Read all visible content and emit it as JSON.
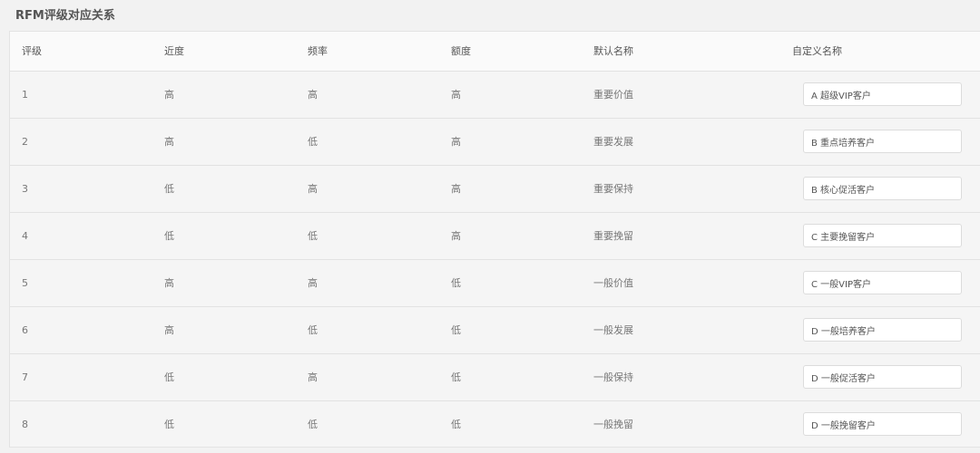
{
  "title": "RFM评级对应关系",
  "headers": [
    "评级",
    "近度",
    "频率",
    "额度",
    "默认名称",
    "自定义名称"
  ],
  "rows": [
    {
      "level": "1",
      "recency": "高",
      "frequency": "高",
      "monetary": "高",
      "default_name": "重要价值",
      "custom_name": "A 超级VIP客户"
    },
    {
      "level": "2",
      "recency": "高",
      "frequency": "低",
      "monetary": "高",
      "default_name": "重要发展",
      "custom_name": "B 重点培养客户"
    },
    {
      "level": "3",
      "recency": "低",
      "frequency": "高",
      "monetary": "高",
      "default_name": "重要保持",
      "custom_name": "B 核心促活客户"
    },
    {
      "level": "4",
      "recency": "低",
      "frequency": "低",
      "monetary": "高",
      "default_name": "重要挽留",
      "custom_name": "C 主要挽留客户"
    },
    {
      "level": "5",
      "recency": "高",
      "frequency": "高",
      "monetary": "低",
      "default_name": "一般价值",
      "custom_name": "C 一般VIP客户"
    },
    {
      "level": "6",
      "recency": "高",
      "frequency": "低",
      "monetary": "低",
      "default_name": "一般发展",
      "custom_name": "D 一般培养客户"
    },
    {
      "level": "7",
      "recency": "低",
      "frequency": "高",
      "monetary": "低",
      "default_name": "一般保持",
      "custom_name": "D 一般促活客户"
    },
    {
      "level": "8",
      "recency": "低",
      "frequency": "低",
      "monetary": "低",
      "default_name": "一般挽留",
      "custom_name": "D 一般挽留客户"
    }
  ]
}
